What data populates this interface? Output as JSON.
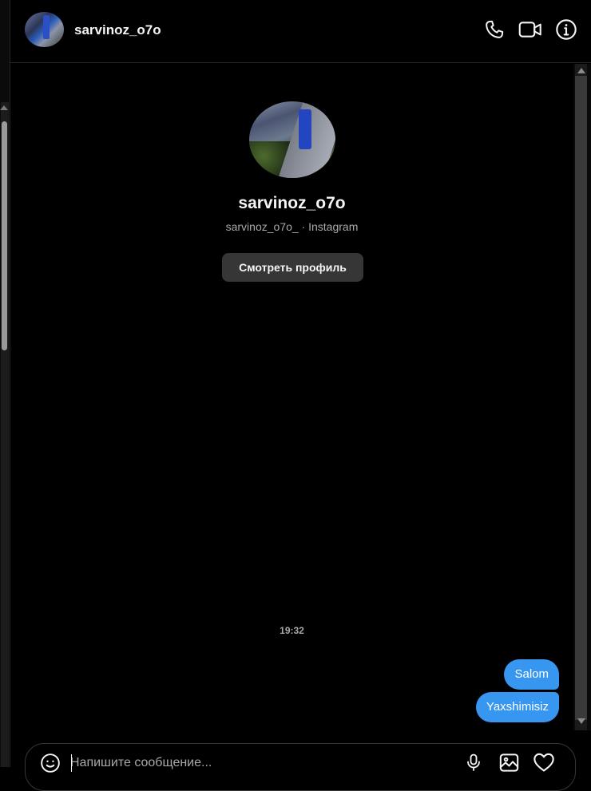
{
  "header": {
    "username": "sarvinoz_o7o",
    "icons": [
      "phone-icon",
      "video-call-icon",
      "info-icon"
    ]
  },
  "profile": {
    "name": "sarvinoz_o7o",
    "subtitle": "sarvinoz_o7o_ · Instagram",
    "view_profile_label": "Смотреть профиль"
  },
  "conversation": {
    "timestamp": "19:32",
    "messages": [
      {
        "text": "Salom",
        "sender": "me"
      },
      {
        "text": "Yaxshimisiz",
        "sender": "me"
      }
    ]
  },
  "composer": {
    "placeholder": "Напишите сообщение...",
    "value": ""
  },
  "colors": {
    "background": "#000000",
    "bubble": "#3797f0",
    "button": "#363636",
    "muted_text": "#a8a8a8"
  }
}
